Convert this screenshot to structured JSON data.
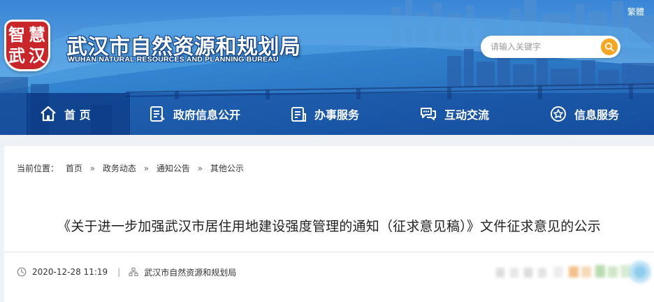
{
  "header": {
    "language_toggle": "繁體",
    "logo_chars": [
      "智",
      "慧",
      "武",
      "汉"
    ],
    "title": "武汉市自然资源和规划局",
    "subtitle": "WUHAN NATURAL RESOURCES AND PLANNING BUREAU",
    "search": {
      "placeholder": "请输入关键字",
      "value": ""
    }
  },
  "nav": {
    "items": [
      {
        "label": "首 页",
        "icon": "home-icon",
        "active": true
      },
      {
        "label": "政府信息公开",
        "icon": "document-icon",
        "active": false
      },
      {
        "label": "办事服务",
        "icon": "clipboard-icon",
        "active": false
      },
      {
        "label": "互动交流",
        "icon": "chat-icon",
        "active": false
      },
      {
        "label": "信息服务",
        "icon": "star-icon",
        "active": false
      }
    ]
  },
  "breadcrumb": {
    "prefix": "当前位置：",
    "items": [
      "首页",
      "政务动态",
      "通知公告",
      "其他公示"
    ],
    "separator": "»"
  },
  "article": {
    "title": "《关于进一步加强武汉市居住用地建设强度管理的通知（征求意见稿）》文件征求意见的公示",
    "date": "2020-12-28 11:19",
    "meta_separator": "|",
    "source": "武汉市自然资源和规划局"
  },
  "colors": {
    "accent": "#f5a623",
    "logo_red": "#c9262b",
    "banner_blue": "#2d7fd0"
  }
}
